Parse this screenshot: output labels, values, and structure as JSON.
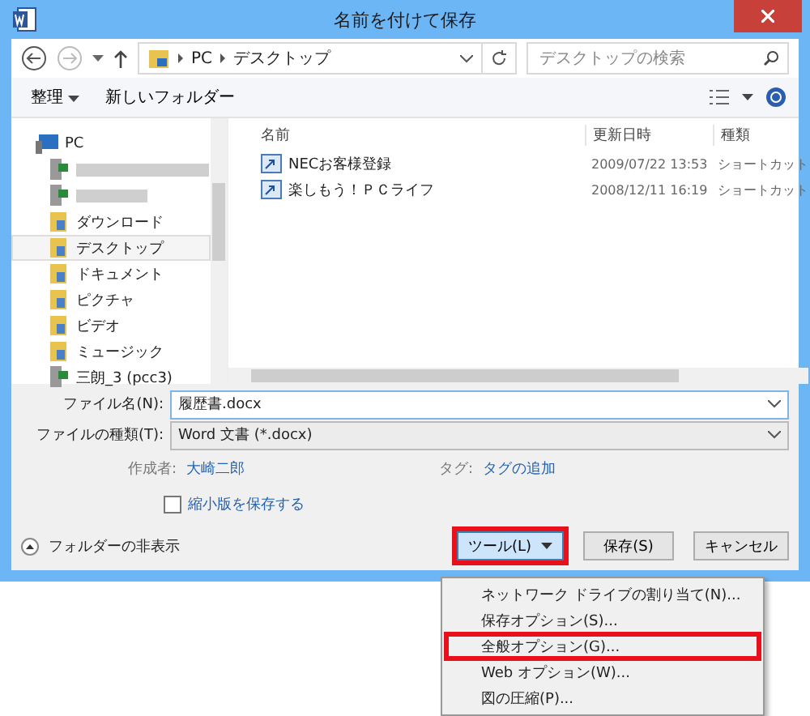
{
  "window": {
    "title": "名前を付けて保存"
  },
  "address": {
    "path": [
      "PC",
      "デスクトップ"
    ],
    "search_placeholder": "デスクトップの検索"
  },
  "toolbar": {
    "organize": "整理",
    "new_folder": "新しいフォルダー"
  },
  "tree": [
    {
      "label": "PC",
      "kind": "computer",
      "selected": false,
      "children": [
        {
          "kind": "blurred-drive",
          "selected": false
        },
        {
          "kind": "blurred-drive",
          "selected": false
        },
        {
          "label": "ダウンロード",
          "kind": "folder",
          "selected": false
        },
        {
          "label": "デスクトップ",
          "kind": "folder",
          "selected": true
        },
        {
          "label": "ドキュメント",
          "kind": "folder",
          "selected": false
        },
        {
          "label": "ピクチャ",
          "kind": "folder",
          "selected": false
        },
        {
          "label": "ビデオ",
          "kind": "folder",
          "selected": false
        },
        {
          "label": "ミュージック",
          "kind": "folder",
          "selected": false
        },
        {
          "label": "三朗_3 (pcc3)",
          "kind": "drive",
          "selected": false
        }
      ]
    }
  ],
  "table": {
    "columns": [
      "名前",
      "更新日時",
      "種類"
    ],
    "rows": [
      [
        "NECお客様登録",
        "2009/07/22 13:53",
        "ショートカット"
      ],
      [
        "楽しもう！ＰＣライフ",
        "2008/12/11 16:19",
        "ショートカット"
      ]
    ]
  },
  "form": {
    "filename_label": "ファイル名(N):",
    "filename": "履歴書.docx",
    "filetype_label": "ファイルの種類(T):",
    "filetype": "Word 文書 (*.docx)",
    "author_label": "作成者:",
    "author": "大崎二郎",
    "tags_label": "タグ:",
    "tags": "タグの追加",
    "thumbnail_label": "縮小版を保存する",
    "thumbnail_checked": false
  },
  "footer": {
    "hide_folders": "フォルダーの非表示",
    "tools": "ツール(L)",
    "tools_highlighted": true,
    "save": "保存(S)",
    "cancel": "キャンセル"
  },
  "menu": [
    {
      "label": "ネットワーク ドライブの割り当て(N)...",
      "highlighted": false
    },
    {
      "label": "保存オプション(S)...",
      "highlighted": false
    },
    {
      "label": "全般オプション(G)...",
      "highlighted": true
    },
    {
      "label": "Web オプション(W)...",
      "highlighted": false
    },
    {
      "label": "図の圧縮(P)...",
      "highlighted": false
    }
  ]
}
